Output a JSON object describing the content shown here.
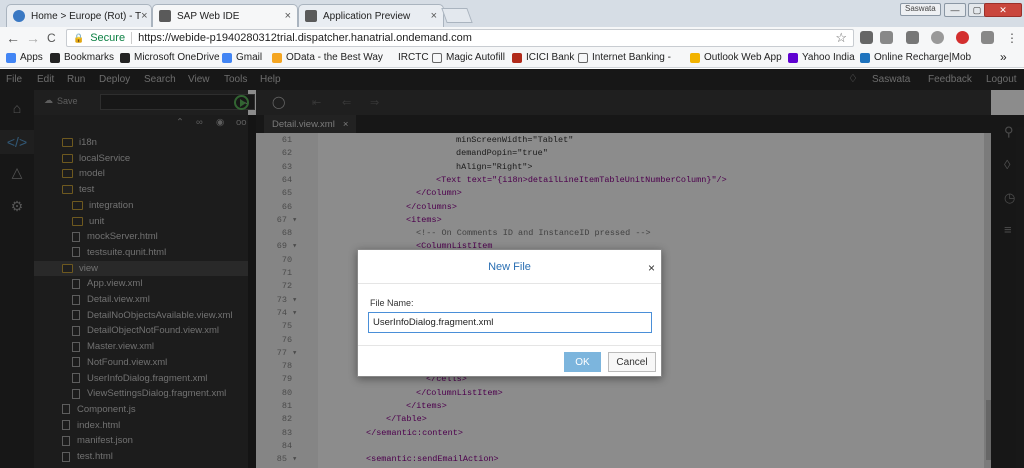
{
  "browser": {
    "tabs": [
      {
        "title": "Home > Europe (Rot) - T",
        "favicon_color": "#3a78c3"
      },
      {
        "title": "SAP Web IDE",
        "favicon_color": "#5a5a5a"
      },
      {
        "title": "Application Preview",
        "favicon_color": "#5a5a5a"
      }
    ],
    "close_glyph": "×",
    "profile_label": "Saswata",
    "window_buttons": [
      "—",
      "▢",
      "✕"
    ],
    "nav": {
      "back": "←",
      "forward": "→",
      "reload": "C"
    },
    "address": {
      "secure_label": "Secure",
      "url": "https://webide-p1940280312trial.dispatcher.hanatrial.ondemand.com",
      "star": "☆"
    },
    "extensions": [
      "#666666",
      "#888888",
      "#777777",
      "#999999",
      "#d32f2f",
      "#888888",
      "#666666"
    ],
    "bookmarks": [
      {
        "label": "Apps",
        "icon": "apps-grid-icon",
        "color": "#4285f4"
      },
      {
        "label": "Bookmarks",
        "icon": "star-icon",
        "color": "#222222"
      },
      {
        "label": "Microsoft OneDrive",
        "icon": "cloud-icon",
        "color": "#222222"
      },
      {
        "label": "Gmail",
        "icon": "google-icon",
        "color": "#4285f4"
      },
      {
        "label": "OData - the Best Way",
        "icon": "odata-icon",
        "color": "#f4a521"
      },
      {
        "label": "IRCTC",
        "icon": "irctc-icon",
        "color": "#ffffff"
      },
      {
        "label": "Magic Autofill",
        "icon": "page-icon",
        "color": "#ffffff"
      },
      {
        "label": "ICICI Bank",
        "icon": "icici-icon",
        "color": "#b12a1a"
      },
      {
        "label": "Internet Banking - IDB",
        "icon": "page-icon",
        "color": "#ffffff"
      },
      {
        "label": "Outlook Web App",
        "icon": "outlook-icon",
        "color": "#f2b300"
      },
      {
        "label": "Yahoo India",
        "icon": "yahoo-icon",
        "color": "#5f01d1"
      },
      {
        "label": "Online Recharge|Mob",
        "icon": "recharge-icon",
        "color": "#1e73be"
      }
    ],
    "bookmarks_more": "»"
  },
  "ide": {
    "menu": [
      "File",
      "Edit",
      "Run",
      "Deploy",
      "Search",
      "View",
      "Tools",
      "Help"
    ],
    "user": "Saswata",
    "feedback": "Feedback",
    "logout": "Logout",
    "save_label": "Save",
    "editor_tab": "Detail.view.xml",
    "editor_tab_close": "×"
  },
  "tree": [
    {
      "label": "i18n",
      "type": "folder"
    },
    {
      "label": "localService",
      "type": "folder"
    },
    {
      "label": "model",
      "type": "folder"
    },
    {
      "label": "test",
      "type": "folder-open"
    },
    {
      "label": "integration",
      "type": "folder"
    },
    {
      "label": "unit",
      "type": "folder"
    },
    {
      "label": "mockServer.html",
      "type": "file"
    },
    {
      "label": "testsuite.qunit.html",
      "type": "file"
    },
    {
      "label": "view",
      "type": "folder-open",
      "selected": true
    },
    {
      "label": "App.view.xml",
      "type": "file"
    },
    {
      "label": "Detail.view.xml",
      "type": "file"
    },
    {
      "label": "DetailNoObjectsAvailable.view.xml",
      "type": "file"
    },
    {
      "label": "DetailObjectNotFound.view.xml",
      "type": "file"
    },
    {
      "label": "Master.view.xml",
      "type": "file"
    },
    {
      "label": "NotFound.view.xml",
      "type": "file"
    },
    {
      "label": "UserInfoDialog.fragment.xml",
      "type": "file"
    },
    {
      "label": "ViewSettingsDialog.fragment.xml",
      "type": "file"
    },
    {
      "label": "Component.js",
      "type": "file"
    },
    {
      "label": "index.html",
      "type": "file"
    },
    {
      "label": "manifest.json",
      "type": "file"
    },
    {
      "label": "test.html",
      "type": "file"
    }
  ],
  "code": [
    {
      "n": "61",
      "t": "minScreenWidth=\"Tablet\"",
      "i": 13,
      "c": "#333333"
    },
    {
      "n": "62",
      "t": "demandPopin=\"true\"",
      "i": 13,
      "c": "#333333"
    },
    {
      "n": "63",
      "t": "hAlign=\"Right\">",
      "i": 13,
      "c": "#333333"
    },
    {
      "n": "64",
      "t": "<Text text=\"{i18n>detailLineItemTableUnitNumberColumn}\"/>",
      "i": 11,
      "c": "#8b008b"
    },
    {
      "n": "65",
      "t": "</Column>",
      "i": 9,
      "c": "#8b008b"
    },
    {
      "n": "66",
      "t": "</columns>",
      "i": 8,
      "c": "#8b008b"
    },
    {
      "n": "67 ▾",
      "t": "<items>",
      "i": 8,
      "c": "#8b008b"
    },
    {
      "n": "68",
      "t": "<!-- On Comments ID and InstanceID pressed -->",
      "i": 9,
      "c": "#777777"
    },
    {
      "n": "69 ▾",
      "t": "<ColumnListItem",
      "i": 9,
      "c": "#8b008b"
    },
    {
      "n": "70",
      "t": "",
      "i": 0,
      "c": "#333333"
    },
    {
      "n": "71",
      "t": "",
      "i": 0,
      "c": "#333333"
    },
    {
      "n": "72",
      "t": "",
      "i": 0,
      "c": "#333333"
    },
    {
      "n": "73 ▾",
      "t": "",
      "i": 0,
      "c": "#333333"
    },
    {
      "n": "74 ▾",
      "t": "",
      "i": 0,
      "c": "#333333"
    },
    {
      "n": "75",
      "t": "",
      "i": 0,
      "c": "#333333"
    },
    {
      "n": "76",
      "t": "",
      "i": 0,
      "c": "#333333"
    },
    {
      "n": "77 ▾",
      "t": "",
      "i": 0,
      "c": "#333333"
    },
    {
      "n": "78",
      "t": "",
      "i": 0,
      "c": "#333333"
    },
    {
      "n": "79",
      "t": "</cells>",
      "i": 10,
      "c": "#8b008b"
    },
    {
      "n": "80",
      "t": "</ColumnListItem>",
      "i": 9,
      "c": "#8b008b"
    },
    {
      "n": "81",
      "t": "</items>",
      "i": 8,
      "c": "#8b008b"
    },
    {
      "n": "82",
      "t": "</Table>",
      "i": 6,
      "c": "#8b008b"
    },
    {
      "n": "83",
      "t": "</semantic:content>",
      "i": 4,
      "c": "#8b008b"
    },
    {
      "n": "84",
      "t": "",
      "i": 0,
      "c": "#333333"
    },
    {
      "n": "85 ▾",
      "t": "<semantic:sendEmailAction>",
      "i": 4,
      "c": "#8b008b"
    }
  ],
  "dialog": {
    "title": "New File",
    "close": "×",
    "file_name_label": "File Name:",
    "file_name_value": "UserInfoDialog.fragment.xml",
    "ok_label": "OK",
    "cancel_label": "Cancel"
  }
}
